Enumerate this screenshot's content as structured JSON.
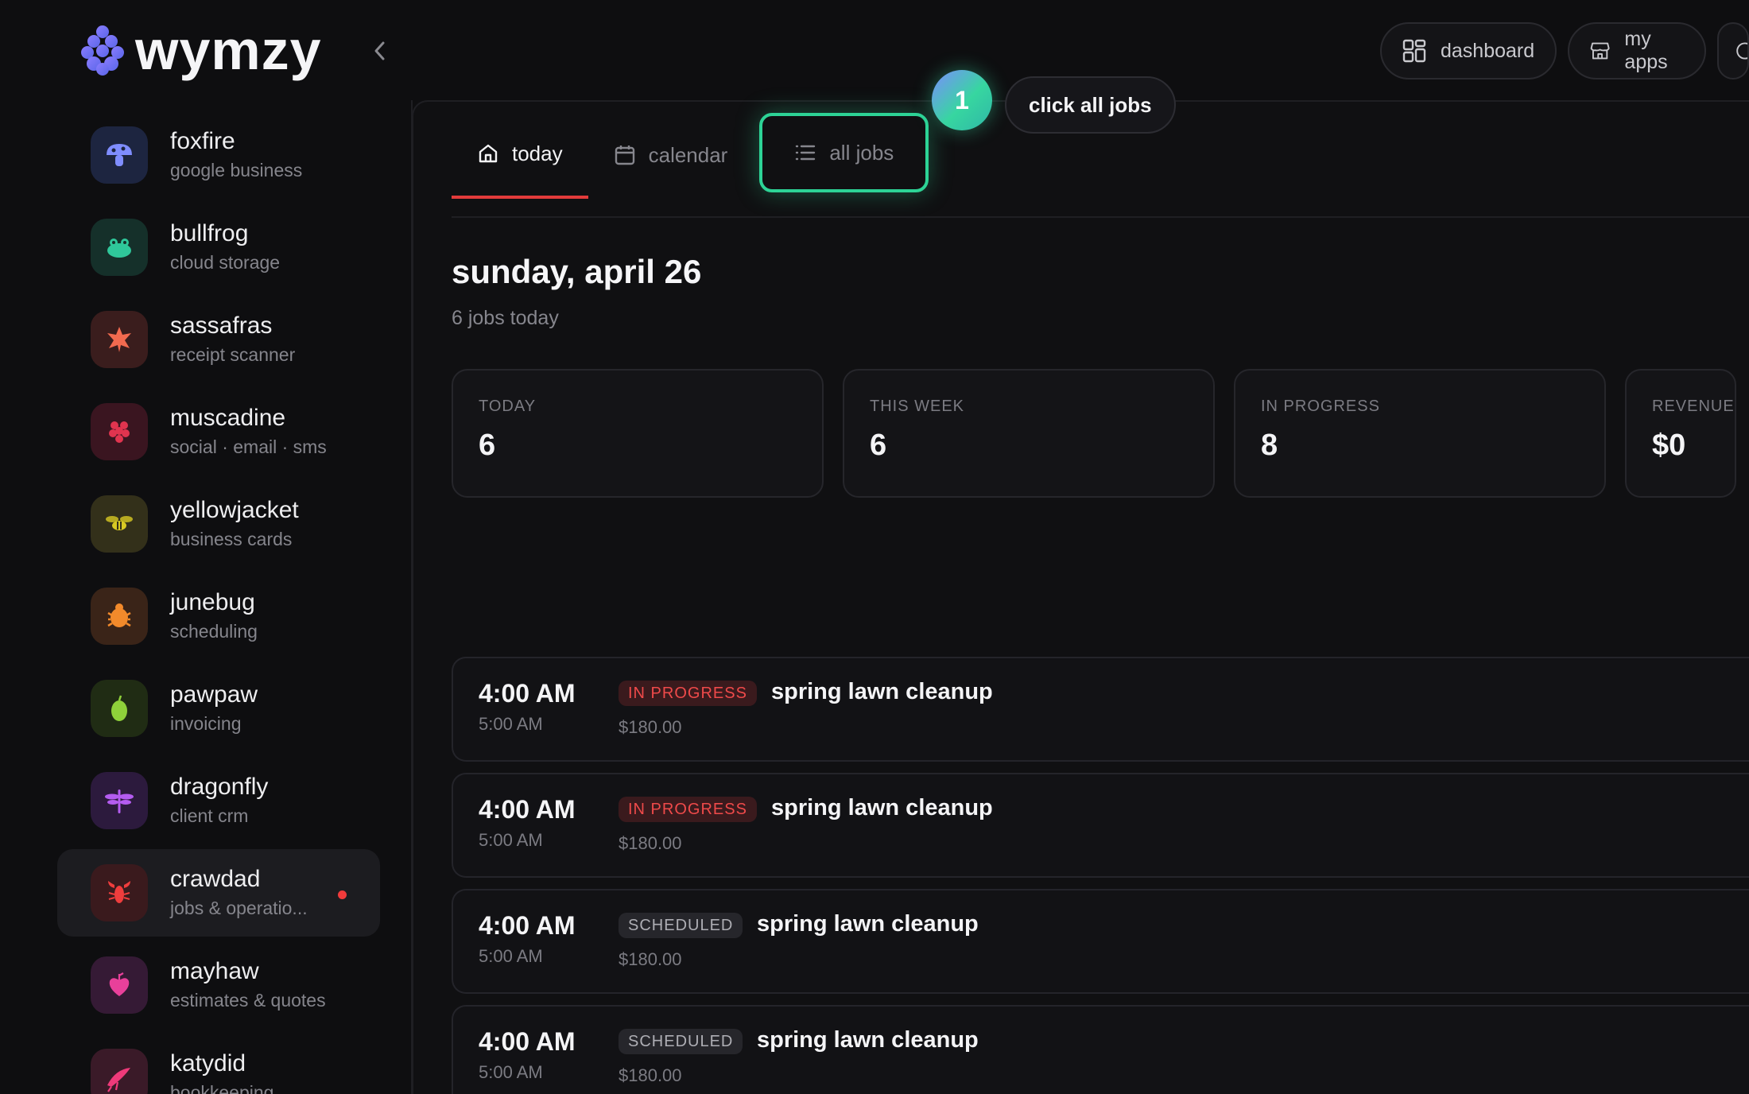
{
  "brand": {
    "name": "wymzy"
  },
  "sidebar": {
    "apps": [
      {
        "name": "foxfire",
        "sub": "google business",
        "icon": "mushroom-icon",
        "bg": "#1d2540",
        "fg": "#7f8dff"
      },
      {
        "name": "bullfrog",
        "sub": "cloud storage",
        "icon": "frog-icon",
        "bg": "#15302a",
        "fg": "#2fc79a"
      },
      {
        "name": "sassafras",
        "sub": "receipt scanner",
        "icon": "leaf-icon",
        "bg": "#3a1d1d",
        "fg": "#f26a4f"
      },
      {
        "name": "muscadine",
        "sub": "social · email · sms",
        "icon": "grapes-icon",
        "bg": "#3a1520",
        "fg": "#e0344f"
      },
      {
        "name": "yellowjacket",
        "sub": "business cards",
        "icon": "wasp-icon",
        "bg": "#33301a",
        "fg": "#d8c923"
      },
      {
        "name": "junebug",
        "sub": "scheduling",
        "icon": "bug-icon",
        "bg": "#3a2418",
        "fg": "#f28a2b"
      },
      {
        "name": "pawpaw",
        "sub": "invoicing",
        "icon": "fruit-icon",
        "bg": "#202c14",
        "fg": "#8fd13a"
      },
      {
        "name": "dragonfly",
        "sub": "client crm",
        "icon": "dragonfly-icon",
        "bg": "#2c1a3d",
        "fg": "#b45cf0"
      },
      {
        "name": "crawdad",
        "sub": "jobs & operatio...",
        "icon": "crawfish-icon",
        "bg": "#3a1a1d",
        "fg": "#ef3d3d",
        "active": true
      },
      {
        "name": "mayhaw",
        "sub": "estimates & quotes",
        "icon": "berry-icon",
        "bg": "#351a35",
        "fg": "#e8409a"
      },
      {
        "name": "katydid",
        "sub": "bookkeeping",
        "icon": "katydid-icon",
        "bg": "#3a1a28",
        "fg": "#ef3a7a"
      }
    ]
  },
  "topnav": {
    "dashboard": "dashboard",
    "my_apps": "my apps"
  },
  "guide": {
    "step": "1",
    "tip": "click all jobs"
  },
  "tabs": {
    "today": "today",
    "calendar": "calendar",
    "all_jobs": "all jobs"
  },
  "header": {
    "date": "sunday, april 26",
    "subtitle": "6 jobs today"
  },
  "stats": [
    {
      "label": "TODAY",
      "value": "6"
    },
    {
      "label": "THIS WEEK",
      "value": "6"
    },
    {
      "label": "IN PROGRESS",
      "value": "8"
    },
    {
      "label": "REVENUE TI",
      "value": "$0"
    }
  ],
  "jobs": [
    {
      "time": "4:00 AM",
      "end": "5:00 AM",
      "status": "IN PROGRESS",
      "status_kind": "progress",
      "title": "spring lawn cleanup",
      "price": "$180.00"
    },
    {
      "time": "4:00 AM",
      "end": "5:00 AM",
      "status": "IN PROGRESS",
      "status_kind": "progress",
      "title": "spring lawn cleanup",
      "price": "$180.00"
    },
    {
      "time": "4:00 AM",
      "end": "5:00 AM",
      "status": "SCHEDULED",
      "status_kind": "scheduled",
      "title": "spring lawn cleanup",
      "price": "$180.00"
    },
    {
      "time": "4:00 AM",
      "end": "5:00 AM",
      "status": "SCHEDULED",
      "status_kind": "scheduled",
      "title": "spring lawn cleanup",
      "price": "$180.00"
    }
  ]
}
